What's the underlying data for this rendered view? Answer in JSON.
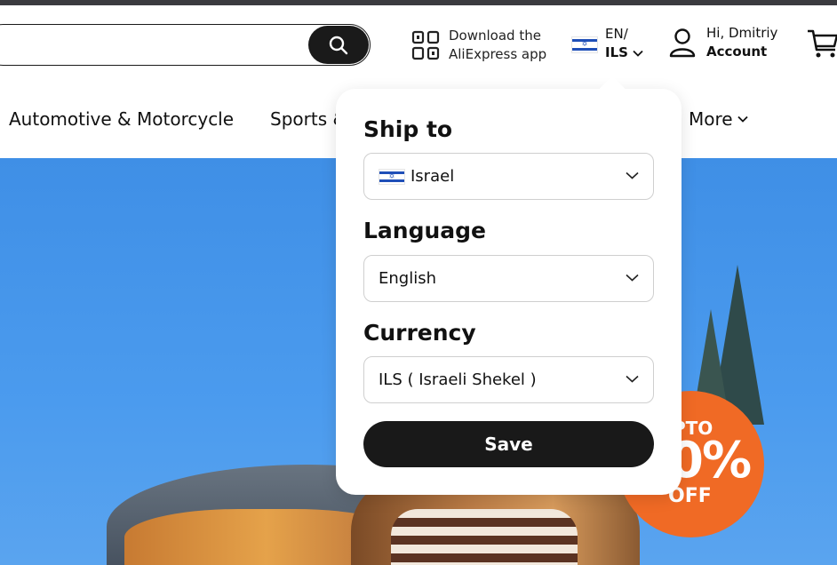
{
  "header": {
    "app_line1": "Download the",
    "app_line2": "AliExpress app",
    "lang_line1": "EN/",
    "lang_line2": "ILS",
    "greeting": "Hi, Dmitriy",
    "account": "Account"
  },
  "nav": {
    "items": [
      "Automotive & Motorcycle",
      "Sports &",
      "More"
    ]
  },
  "banner": {
    "badge_line1": "PTO",
    "badge_line2": "0%",
    "badge_line3": "OFF"
  },
  "panel": {
    "ship_to_title": "Ship to",
    "ship_to_value": "Israel",
    "language_title": "Language",
    "language_value": "English",
    "currency_title": "Currency",
    "currency_value": "ILS ( Israeli Shekel )",
    "save_label": "Save"
  },
  "colors": {
    "dark": "#191919",
    "hero_blue": "#4b9bee",
    "badge_orange": "#f06a25",
    "flag_blue": "#1f4fb8"
  },
  "icons": [
    "search-icon",
    "qr-code-icon",
    "israel-flag-icon",
    "chevron-down-icon",
    "user-icon",
    "cart-icon"
  ]
}
